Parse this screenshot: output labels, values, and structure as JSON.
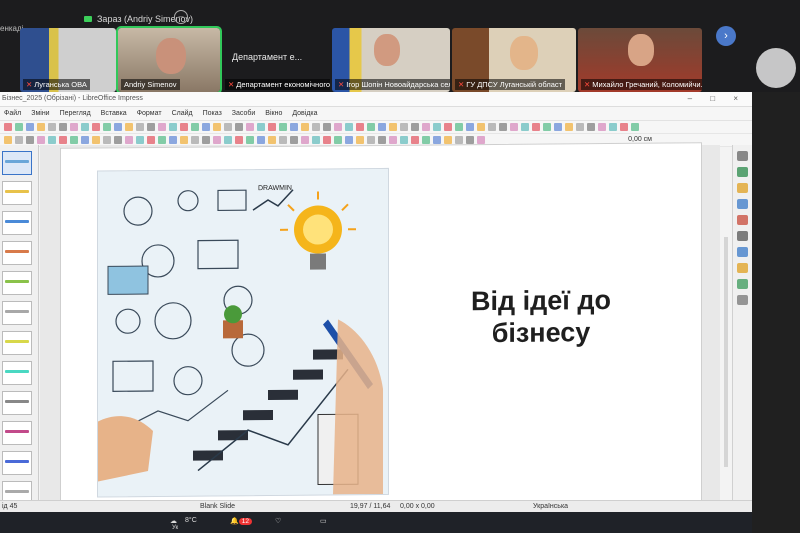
{
  "conference": {
    "share_label": "Зараз (Andriy Simenov)",
    "top_left_text": "енкаді",
    "minimize_glyph": "–",
    "tiles": [
      {
        "name": "Луганська ОВА",
        "label": ""
      },
      {
        "name": "Andriy Simenov",
        "label": ""
      },
      {
        "name": "Департамент економічного ро...",
        "label": "Департамент е..."
      },
      {
        "name": "Ігор Шопін Новоайдарська сел...",
        "label": ""
      },
      {
        "name": "ГУ ДПСУ Луганській област",
        "label": ""
      },
      {
        "name": "Михайло Гречаний, Коломийчи...",
        "label": ""
      }
    ],
    "next_glyph": "›"
  },
  "app": {
    "window_title": "Бізнес_2025 (Обрізані) - LibreOffice Impress",
    "window_controls": "– □ ×",
    "menu": [
      "Файл",
      "Зміни",
      "Перегляд",
      "Вставка",
      "Формат",
      "Слайд",
      "Показ",
      "Засоби",
      "Вікно",
      "Довідка"
    ],
    "zoom_value": "0,00 см",
    "status": {
      "page": "ід 45",
      "layout": "Blank Slide",
      "coords": "19,97 / 11,64",
      "size": "0,00 x 0,00",
      "language": "Українська"
    },
    "taskbar": {
      "temp": "8°C",
      "notif_count": "12",
      "item": "Ук"
    }
  },
  "slide": {
    "title_line1": "Від ідеї до",
    "title_line2": "бізнесу",
    "image_caption": "DRAWMIN"
  },
  "colors": {
    "accent_green": "#31c85a",
    "bulb_yellow": "#f5b51b"
  },
  "icons": {
    "next": "chevron-right-icon",
    "minimize": "minimize-icon"
  }
}
